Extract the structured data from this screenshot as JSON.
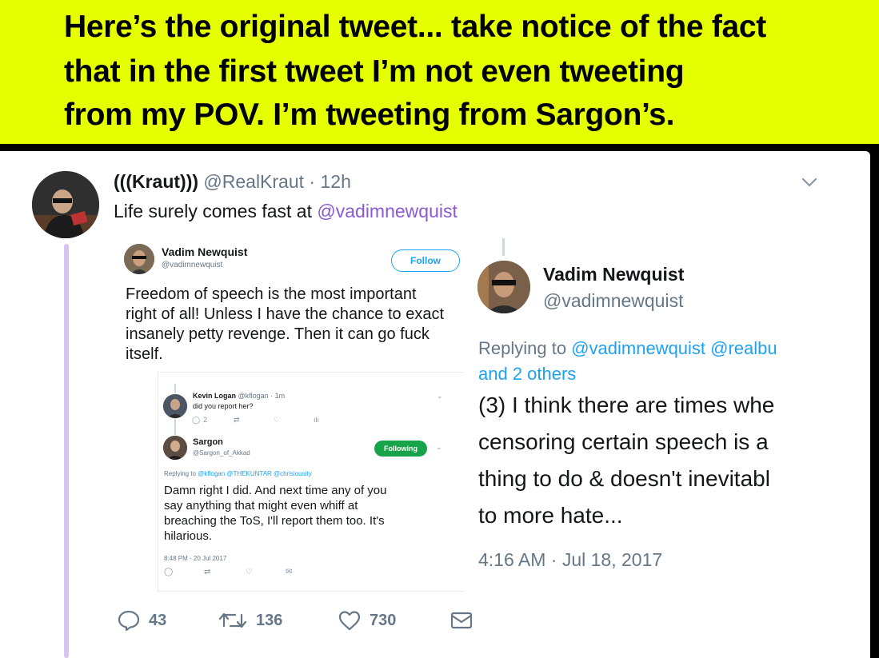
{
  "banner": {
    "line1": "Here’s the original tweet... take notice of the fact",
    "line2": "that in the first tweet I’m not even tweeting",
    "line3": "from my POV. I’m tweeting from Sargon’s."
  },
  "tweet": {
    "author_name": "(((Kraut)))",
    "author_handle": "@RealKraut",
    "separator": " · ",
    "time": "12h",
    "text_prefix": "Life surely comes fast at ",
    "text_mention": "@vadimnewquist",
    "icons": {
      "more": "chevron-down-icon"
    }
  },
  "embed_left": {
    "name": "Vadim Newquist",
    "handle": "@vadimnewquist",
    "follow_label": "Follow",
    "body_lines": [
      "Freedom of speech is the most important",
      "right of all! Unless I have the chance to exact",
      "insanely petty revenge. Then it can go fuck",
      "itself."
    ],
    "nested": {
      "reply1": {
        "name": "Kevin Logan",
        "meta": " @kflogan · 1m",
        "text": "did you report her?",
        "reply_count": "2"
      },
      "reply2": {
        "name": "Sargon",
        "handle": "@Sargon_of_Akkad",
        "following_label": "Following",
        "replying_prefix": "Replying to ",
        "replying_mentions": "@kflogan @THEKUNTAR @chrisiousity",
        "body_lines": [
          "Damn right I did. And next time any of you",
          "say anything that might even whiff at",
          "breaching the ToS, I'll report them too. It's",
          "hilarious."
        ],
        "timestamp": "8:48 PM - 20 Jul 2017"
      }
    }
  },
  "embed_right": {
    "name": "Vadim Newquist",
    "handle": "@vadimnewquist",
    "replying_prefix": "Replying to ",
    "replying_mentions": "@vadimnewquist @realbu",
    "replying_line2": "and 2 others",
    "body_lines": [
      "(3) I think there are times whe",
      "censoring certain speech is a",
      "thing to do & doesn't inevitabl",
      "to more hate..."
    ],
    "timestamp": "4:16 AM · Jul 18, 2017"
  },
  "actions": {
    "reply_count": "43",
    "retweet_count": "136",
    "like_count": "730"
  },
  "colors": {
    "banner": "#e5ff00",
    "mention": "#8b5ad3",
    "thread_line": "#d6c4f1",
    "link": "#1da1f2",
    "following": "#17a34a"
  }
}
